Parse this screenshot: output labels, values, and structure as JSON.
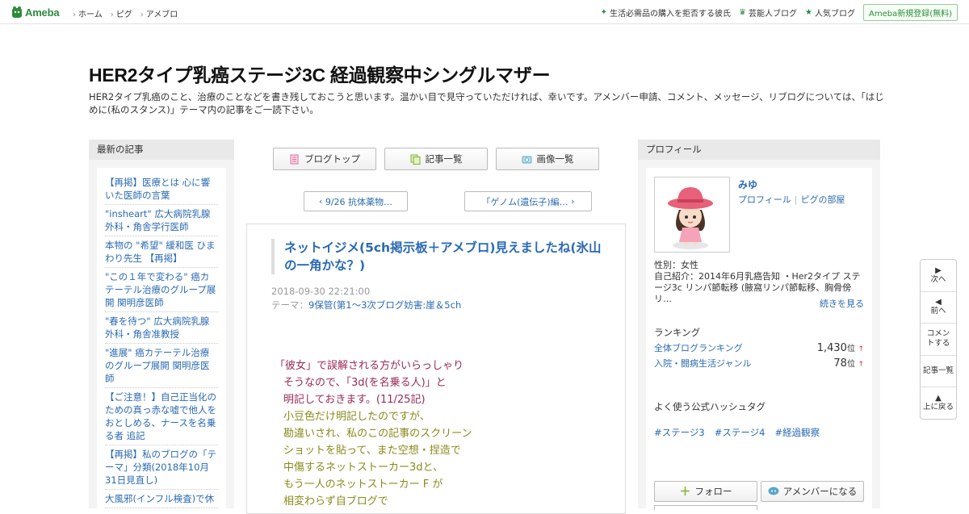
{
  "topbar": {
    "logo": "Ameba",
    "nav": [
      "ホーム",
      "ピグ",
      "アメブロ"
    ],
    "right_links": [
      {
        "icon": "sparkle-icon",
        "label": "生活必需品の購入を拒否する彼氏"
      },
      {
        "icon": "crown-icon",
        "label": "芸能人ブログ"
      },
      {
        "icon": "star-icon",
        "label": "人気ブログ"
      }
    ],
    "register": "Ameba新規登録(無料)"
  },
  "blog": {
    "title": "HER2タイプ乳癌ステージ3C 経過観察中シングルマザー",
    "description": "HER2タイプ乳癌のこと、治療のことなどを書き残しておこうと思います。温かい目で見守っていただければ、幸いです。アメンバー申請、コメント、メッセージ、リブログについては、「はじめに(私のスタンス)」テーマ内の記事をご一読下さい。"
  },
  "left": {
    "heading": "最新の記事",
    "items": [
      "【再掲】医療とは 心に響いた医師の言葉",
      "\"insheart\" 広大病院乳腺外科・角舎学行医師",
      "本物の \"希望\" 緩和医 ひまわり先生 【再掲】",
      "\"この１年で変わる\" 癌カテーテル治療のグループ展開 関明彦医師",
      "\"春を待つ\" 広大病院乳腺外科・角舎准教授",
      "\"進展\" 癌カテーテル治療のグループ展開 関明彦医師",
      "【ご注意！】自己正当化のための真っ赤な嘘で他人をおとしめる、ナースを名乗る者 追記",
      "【再掲】私のブログの「テーマ」分類(2018年10月31日見直し)",
      "大風邪(インフル検査)で休"
    ]
  },
  "center": {
    "buttons": [
      {
        "icon": "document-icon",
        "label": "ブログトップ"
      },
      {
        "icon": "copy-icon",
        "label": "記事一覧"
      },
      {
        "icon": "camera-icon",
        "label": "画像一覧"
      }
    ],
    "prev": "9/26 抗体薬物…",
    "next": "「ゲノム(遺伝子)編…",
    "entry": {
      "title": "ネットイジメ(5ch掲示板＋アメブロ)見えましたね(氷山の一角かな？)",
      "date": "2018-09-30 22:21:00",
      "theme_label": "テーマ：",
      "theme": "9保管(第1～3次ブログ妨害:崖＆5ch",
      "lines": [
        {
          "text": "「彼女」で誤解される方がいらっしゃり",
          "color": "red",
          "indent": false
        },
        {
          "text": "そうなので、「3d(を名乗る人)」と",
          "color": "red",
          "indent": true
        },
        {
          "text": "明記しておきます。(11/25記)",
          "color": "red",
          "indent": true
        },
        {
          "text": "小豆色だけ明記したのですが、",
          "color": "olive",
          "indent": true
        },
        {
          "text": "勘違いされ、私のこの記事のスクリーン",
          "color": "olive",
          "indent": true
        },
        {
          "text": "ショットを貼って、また空想・捏造で",
          "color": "olive",
          "indent": true
        },
        {
          "text": "中傷するネットストーカー3dと、",
          "color": "olive",
          "indent": true
        },
        {
          "text": "もう一人のネットストーカー F が",
          "color": "olive",
          "indent": true
        },
        {
          "text": "相変わらず自ブログで",
          "color": "olive",
          "indent": true
        }
      ]
    }
  },
  "right": {
    "heading": "プロフィール",
    "name": "みゆ",
    "link_profile": "プロフィール",
    "link_pig": "ピグの部屋",
    "gender": "性別：女性",
    "intro": "自己紹介：2014年6月乳癌告知 ・Her2タイプ ステージ3c リンパ節転移 (腋窩リンパ節転移、胸骨傍リ…",
    "more": "続きを見る",
    "ranking_heading": "ランキング",
    "rankings": [
      {
        "label": "全体ブログランキング",
        "value": "1,430",
        "unit": "位",
        "arrow": "↑"
      },
      {
        "label": "入院・闘病生活ジャンル",
        "value": "78",
        "unit": "位",
        "arrow": "↑"
      }
    ],
    "hashtag_heading": "よく使う公式ハッシュタグ",
    "hashtags": [
      "#ステージ3",
      "#ステージ4",
      "#経過観察"
    ],
    "follow": "フォロー",
    "amember": "アメンバーになる"
  },
  "sidenav": [
    {
      "icon": "next-arrow-icon",
      "label": "次へ",
      "glyph": "▶"
    },
    {
      "icon": "prev-arrow-icon",
      "label": "前へ",
      "glyph": "◀"
    },
    {
      "icon": "",
      "label": "コメントする",
      "glyph": ""
    },
    {
      "icon": "",
      "label": "記事一覧",
      "glyph": ""
    },
    {
      "icon": "up-arrow-icon",
      "label": "上に戻る",
      "glyph": "▲"
    }
  ],
  "colors": {
    "brand_green": "#2d8c3c",
    "link_blue": "#2a6ab3",
    "text_red": "#9b2a56",
    "text_olive": "#8a8a1c"
  }
}
